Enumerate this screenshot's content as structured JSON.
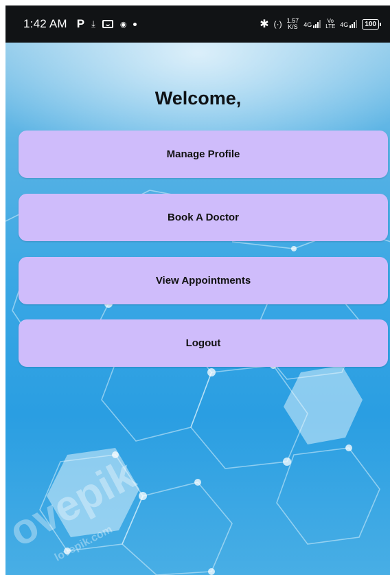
{
  "status_bar": {
    "time": "1:42 AM",
    "p_label": "P",
    "speed_value": "1.57",
    "speed_unit": "K/S",
    "net1_label": "4G",
    "volte_top": "Vo",
    "volte_bottom": "LTE",
    "net2_label": "4G",
    "battery": "100",
    "icons": [
      "download-icon",
      "message-icon",
      "camera-icon",
      "dot-icon",
      "bluetooth-icon",
      "hotspot-icon",
      "signal-icon",
      "battery-icon"
    ]
  },
  "main": {
    "welcome_title": "Welcome,",
    "buttons": [
      {
        "label": "Manage Profile"
      },
      {
        "label": "Book A Doctor"
      },
      {
        "label": "View Appointments"
      },
      {
        "label": "Logout"
      }
    ]
  },
  "watermark": {
    "text_large": "ovepik",
    "text_small": "lovepik.com"
  },
  "colors": {
    "button_bg": "#cfbcfb",
    "status_bar_bg": "#111315",
    "background_blue": "#3aa7e4"
  }
}
